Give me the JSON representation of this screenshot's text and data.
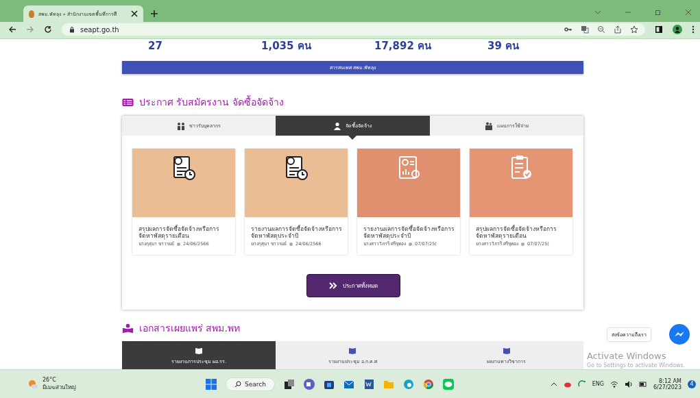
{
  "browser": {
    "tab_title": "สพม.พัทลุง » สำนักงานเขตพื้นที่การศึ",
    "address": "seapt.go.th"
  },
  "stats": [
    "27",
    "1,035 คน",
    "17,892 คน",
    "39 คน"
  ],
  "info_bar": "สารสนเทศ สพม.พัทลุง",
  "announcements": {
    "title": "ประกาศ รับสมัครงาน จัดซื้อจัดจ้าง",
    "tabs": [
      {
        "label": "ข่าวรับบุคลากร",
        "selected": false,
        "kind": "people"
      },
      {
        "label": "จัดซื้อจัดจ้าง",
        "selected": true,
        "kind": "person"
      },
      {
        "label": "แผนการใช้จ่าย",
        "selected": false,
        "kind": "box"
      }
    ],
    "cards": [
      {
        "kind": "document-clock",
        "title": "สรุปผลการจัดซื้อจัดจ้างหรือการจัดหาพัสดุรายเดือน",
        "author": "นางกุสุมา ขาวรมย์",
        "date": "24/06/2566"
      },
      {
        "kind": "document-clock",
        "title": "รายงานผลการจัดซื้อจัดจ้างหรือการจัดหาพัสดุประจำปี",
        "author": "นางกุสุมา ขาวรมย์",
        "date": "24/06/2566"
      },
      {
        "kind": "report-gear",
        "title": "รายงานผลการจัดซื้อจัดจ้างหรือการจัดหาพัสดุประจำปี",
        "author": "นางสาววิภารี ศรีขุทอง",
        "date": "07/07/25("
      },
      {
        "kind": "clipboard-check",
        "title": "สรุปผลการจัดซื้อจัดจ้างหรือการจัดหาพัสดุรายเดือน",
        "author": "นางสาววิภารี ศรีขุทอง",
        "date": "07/07/25("
      }
    ],
    "all_button": "ประกาศทั้งหมด"
  },
  "publications": {
    "title": "เอกสารเผยแพร่ สพม.พท",
    "tabs": [
      {
        "label": "รายงานการประชุม ผอ.รร.",
        "selected": true
      },
      {
        "label": "รายงานประชุม อ.ก.ค.ศ",
        "selected": false
      },
      {
        "label": "ผลงานทางวิชาการ",
        "selected": false
      }
    ]
  },
  "chat_tooltip": "ส่งข้อความถึงเรา",
  "activation": {
    "title": "Activate Windows",
    "hint": "Go to Settings to activate Windows."
  },
  "taskbar": {
    "temperature": "26°C",
    "weather": "มีเมฆส่วนใหญ่",
    "search": "Search",
    "language": "ENG",
    "time": "8:12 AM",
    "date": "6/27/2023",
    "notifications": "4"
  }
}
